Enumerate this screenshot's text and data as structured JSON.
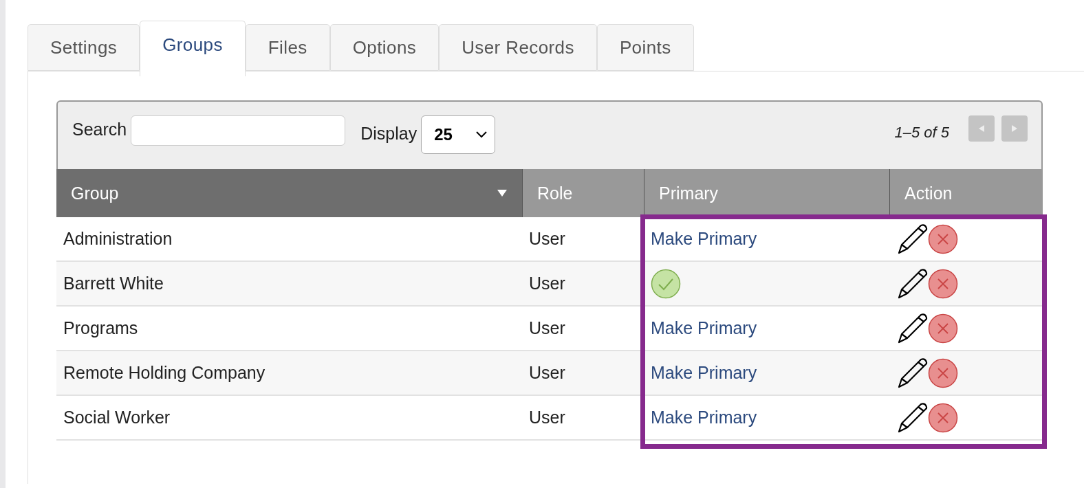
{
  "tabs": [
    {
      "label": "Settings",
      "selected": false
    },
    {
      "label": "Groups",
      "selected": true
    },
    {
      "label": "Files",
      "selected": false
    },
    {
      "label": "Options",
      "selected": false
    },
    {
      "label": "User Records",
      "selected": false
    },
    {
      "label": "Points",
      "selected": false
    }
  ],
  "toolbar": {
    "search_label": "Search",
    "display_label": "Display",
    "display_value": "25",
    "pagination": "1–5 of 5"
  },
  "table": {
    "columns": [
      {
        "label": "Group",
        "sorted": true
      },
      {
        "label": "Role",
        "sorted": false
      },
      {
        "label": "Primary",
        "sorted": false
      },
      {
        "label": "Action",
        "sorted": false
      }
    ],
    "rows": [
      {
        "group": "Administration",
        "role": "User",
        "primary": false,
        "action": "Make Primary"
      },
      {
        "group": "Barrett White",
        "role": "User",
        "primary": true
      },
      {
        "group": "Programs",
        "role": "User",
        "primary": false,
        "action": "Make Primary"
      },
      {
        "group": "Remote Holding Company",
        "role": "User",
        "primary": false,
        "action": "Make Primary"
      },
      {
        "group": "Social Worker",
        "role": "User",
        "primary": false,
        "action": "Make Primary"
      }
    ]
  }
}
